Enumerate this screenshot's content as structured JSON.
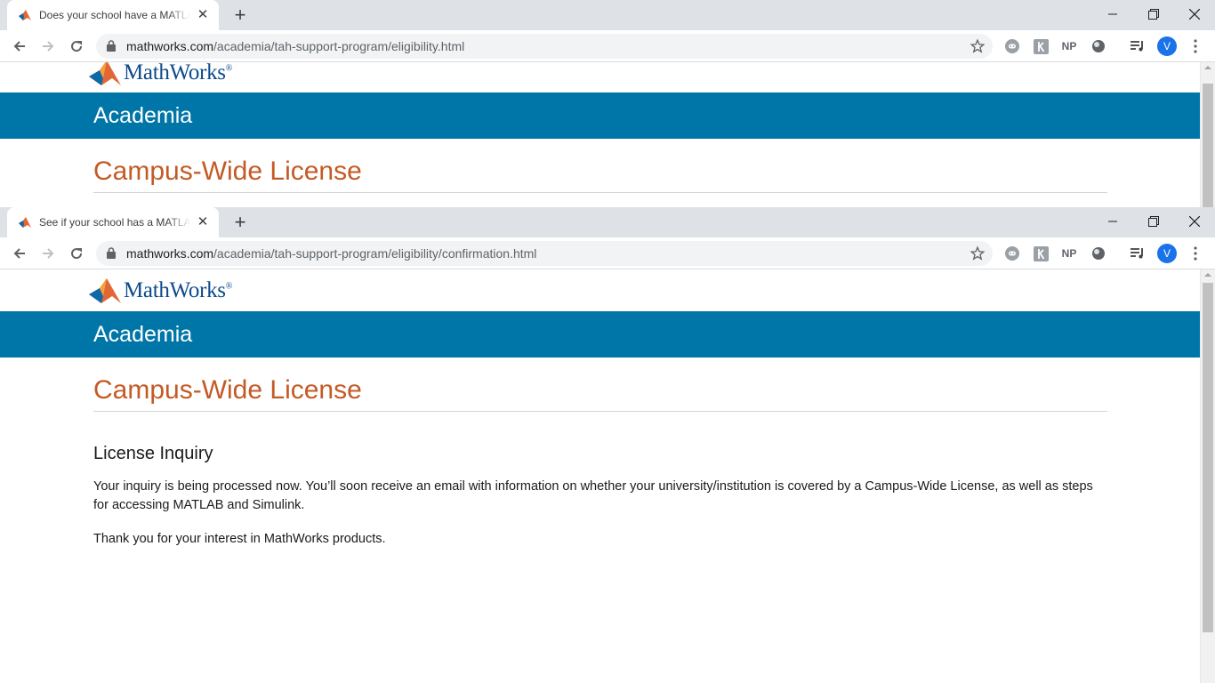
{
  "browser": {
    "minimize_icon": "minimize-icon",
    "maximize_icon": "restore-icon",
    "close_icon": "close-icon",
    "newtab_symbol": "+",
    "tab_close_symbol": "✕",
    "profile_initial": "V",
    "extensions": [
      "discord-icon",
      "extension-k-icon",
      "NP",
      "circle-extension-icon",
      "media-queue-icon"
    ]
  },
  "window1": {
    "tab_title": "Does your school have a MATLAB",
    "url_host": "mathworks.com",
    "url_path": "/academia/tah-support-program/eligibility.html"
  },
  "window2": {
    "tab_title": "See if your school has a MATLAB",
    "url_host": "mathworks.com",
    "url_path": "/academia/tah-support-program/eligibility/confirmation.html"
  },
  "page": {
    "logo_text": "MathWorks",
    "logo_reg": "®",
    "banner_title": "Academia",
    "heading": "Campus-Wide License",
    "section_title": "License Inquiry",
    "paragraph_1": "Your inquiry is being processed now. You’ll soon receive an email with information on whether your university/institution is covered by a Campus-Wide License, as well as steps for accessing MATLAB and Simulink.",
    "paragraph_2": "Thank you for your interest in MathWorks products."
  },
  "colors": {
    "banner": "#0076a8",
    "heading": "#c45a25",
    "logo_text": "#0c4a8a",
    "avatar": "#1a73e8"
  }
}
